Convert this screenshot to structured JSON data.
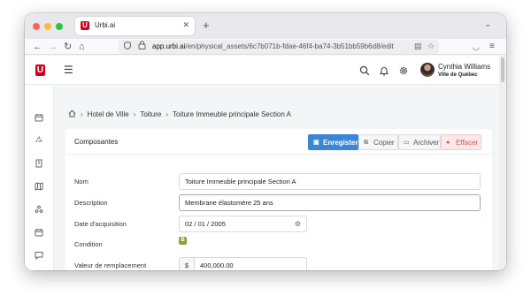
{
  "browser": {
    "tab_title": "Urbi.ai",
    "url_host": "app.urbi.ai",
    "url_path": "/en/physical_assets/6c7b071b-fdae-46f4-ba74-3b51bb59b6d8/edit"
  },
  "app": {
    "logo_text": "U",
    "user": {
      "name": "Cynthia Williams",
      "city": "Ville de Québec"
    }
  },
  "breadcrumb": {
    "items": [
      "Hotel de Ville",
      "Toiture",
      "Toiture Immeuble principale Section A"
    ]
  },
  "card": {
    "title": "Composantes",
    "buttons": {
      "save": "Enregister",
      "copy": "Copier",
      "archive": "Archiver",
      "delete": "Effacer"
    }
  },
  "form": {
    "name_label": "Nom",
    "name_value": "Toiture Immeuble principale Section A",
    "description_label": "Description",
    "description_value": "Membrane élastomère 25 ans",
    "acquisition_label": "Date d'acquisition",
    "acquisition_value": "02 / 01 / 2005",
    "condition_label": "Condition",
    "condition_value": "B",
    "replacement_label": "Valeur de remplacement",
    "currency_symbol": "$",
    "replacement_value": "400,000.00"
  },
  "colors": {
    "brand": "#d0021b",
    "primary_button": "#3a87d6",
    "danger_text": "#d9534f",
    "condition_badge": "#8ca43a"
  }
}
